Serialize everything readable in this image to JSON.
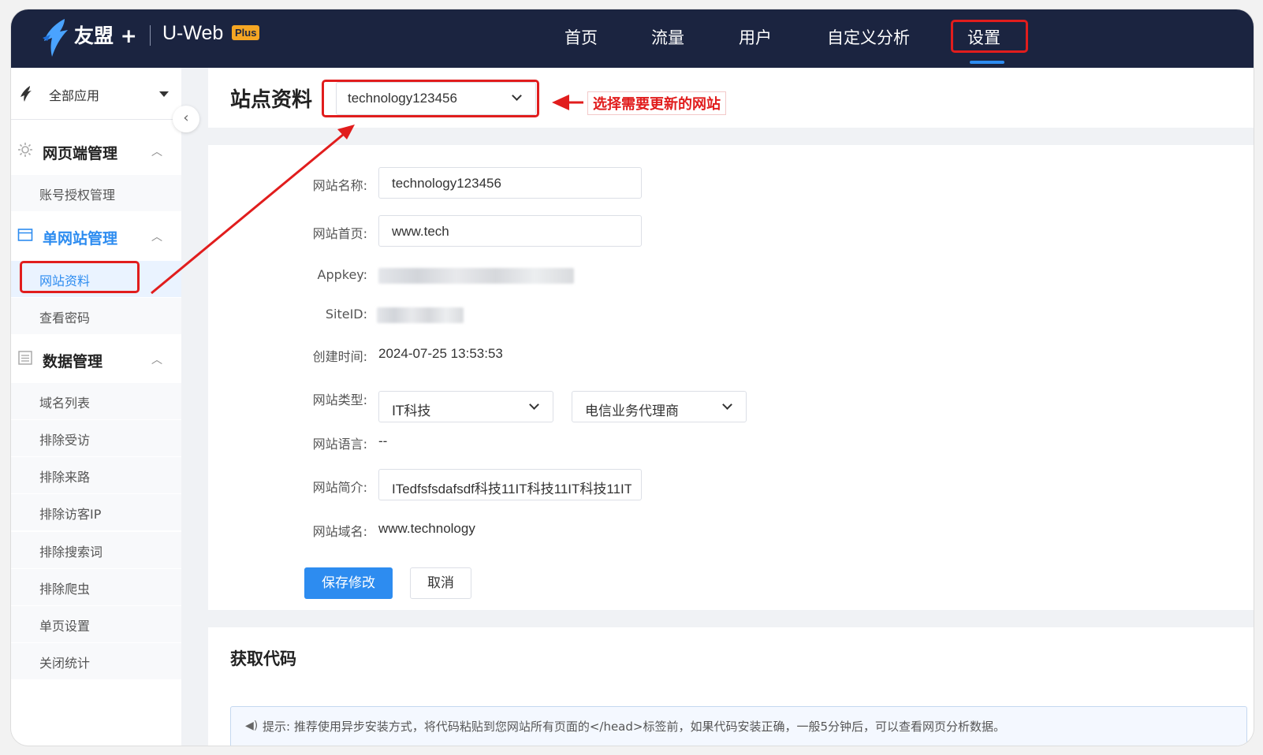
{
  "topnav": {
    "brand": "友盟 +",
    "product": "U-Web",
    "product_badge": "Plus",
    "items": [
      {
        "label": "首页"
      },
      {
        "label": "流量"
      },
      {
        "label": "用户"
      },
      {
        "label": "自定义分析"
      },
      {
        "label": "设置"
      }
    ],
    "active_item": "设置"
  },
  "sidebar": {
    "app_select": "全部应用",
    "sections": [
      {
        "title": "网页端管理",
        "items": [
          "账号授权管理"
        ]
      },
      {
        "title": "单网站管理",
        "items": [
          "网站资料",
          "查看密码"
        ]
      },
      {
        "title": "数据管理",
        "items": [
          "域名列表",
          "排除受访",
          "排除来路",
          "排除访客IP",
          "排除搜索词",
          "排除爬虫",
          "单页设置",
          "关闭统计"
        ]
      }
    ],
    "active_item": "网站资料"
  },
  "header": {
    "title": "站点资料",
    "site_select_value": "technology123456",
    "annotation": "选择需要更新的网站"
  },
  "form": {
    "name_label": "网站名称:",
    "name_value": "technology123456",
    "homepage_label": "网站首页:",
    "homepage_value": "www.tech",
    "appkey_label": "Appkey:",
    "siteid_label": "SiteID:",
    "created_label": "创建时间:",
    "created_value": "2024-07-25 13:53:53",
    "type_label": "网站类型:",
    "type_primary": "IT科技",
    "type_secondary": "电信业务代理商",
    "language_label": "网站语言:",
    "language_value": "--",
    "intro_label": "网站简介:",
    "intro_value": "ITedfsfsdafsdf科技11IT科技11IT科技11IT",
    "domain_label": "网站域名:",
    "domain_value": "www.technology",
    "save_label": "保存修改",
    "cancel_label": "取消"
  },
  "code": {
    "title": "获取代码",
    "tip": "提示: 推荐使用异步安装方式，将代码粘贴到您网站所有页面的</head>标签前，如果代码安装正确，一般5分钟后，可以查看网页分析数据。"
  },
  "colors": {
    "topnav_bg": "#1b2440",
    "accent": "#2d8cf0",
    "annotation_red": "#e11d1d",
    "plus_badge": "#f5a623"
  }
}
